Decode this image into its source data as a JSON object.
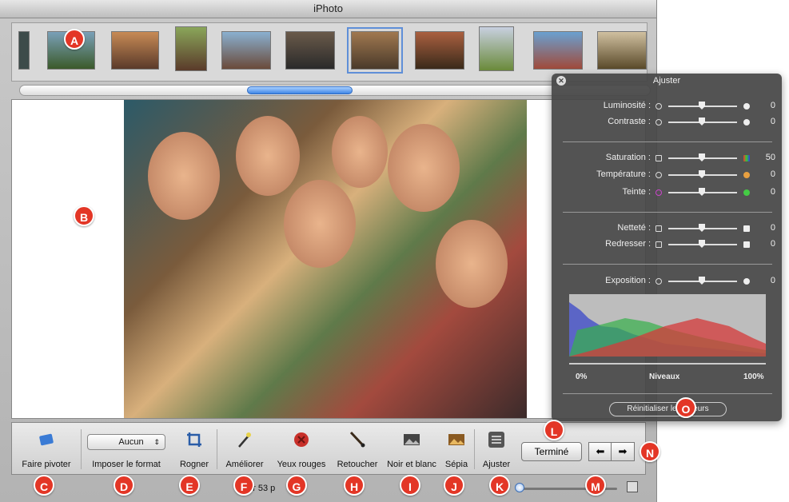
{
  "window": {
    "title": "iPhoto"
  },
  "toolbar": {
    "rotate": "Faire pivoter",
    "constrain": "Imposer le format",
    "constrain_value": "Aucun",
    "crop": "Rogner",
    "enhance": "Améliorer",
    "redeye": "Yeux rouges",
    "retouch": "Retoucher",
    "bw": "Noir et blanc",
    "sepia": "Sépia",
    "adjust": "Ajuster",
    "done": "Terminé",
    "prev_icon": "arrow-left-icon",
    "next_icon": "arrow-right-icon"
  },
  "status": {
    "text": "ur 53 p"
  },
  "adjust_panel": {
    "title": "Ajuster",
    "rows": [
      {
        "label": "Luminosité :",
        "value": "0"
      },
      {
        "label": "Contraste :",
        "value": "0"
      },
      {
        "label": "Saturation :",
        "value": "50"
      },
      {
        "label": "Température :",
        "value": "0"
      },
      {
        "label": "Teinte :",
        "value": "0"
      },
      {
        "label": "Netteté :",
        "value": "0"
      },
      {
        "label": "Redresser :",
        "value": "0"
      },
      {
        "label": "Exposition :",
        "value": "0"
      }
    ],
    "levels_min": "0%",
    "levels_label": "Niveaux",
    "levels_max": "100%",
    "reset": "Réinitialiser les valeurs"
  },
  "callouts": [
    "A",
    "B",
    "C",
    "D",
    "E",
    "F",
    "G",
    "H",
    "I",
    "J",
    "K",
    "L",
    "M",
    "N",
    "O"
  ],
  "colors": {
    "callout": "#e33626",
    "accent": "#3e86e6",
    "panel": "#464646"
  }
}
